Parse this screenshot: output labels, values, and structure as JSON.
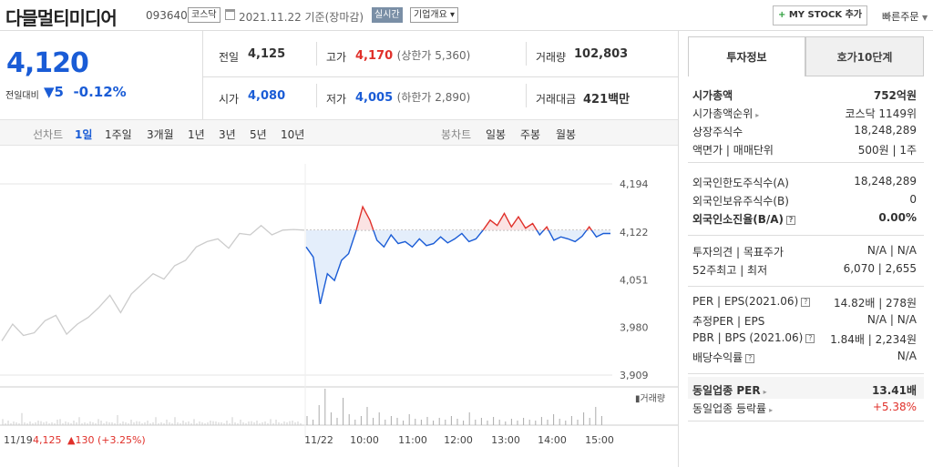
{
  "header": {
    "title": "다믈멀티미디어",
    "code": "093640",
    "market": "코스닥",
    "date": "2021.11.22  기준(장마감)",
    "realtime": "실시간",
    "company_info": "기업개요 ▾",
    "mystock": "MY STOCK 추가",
    "mystock_plus": "+",
    "quick_order": "빠른주문"
  },
  "summary": {
    "price": "4,120",
    "change_label": "전일대비",
    "change_value": "▼5",
    "change_rate": "-0.12%",
    "prev_label": "전일",
    "prev": "4,125",
    "open_label": "시가",
    "open": "4,080",
    "high_label": "고가",
    "high": "4,170",
    "high_limit": "(상한가 5,360)",
    "low_label": "저가",
    "low": "4,005",
    "low_limit": "(하한가 2,890)",
    "volume_label": "거래량",
    "volume": "102,803",
    "amount_label": "거래대금",
    "amount": "421백만"
  },
  "periods": {
    "line_label": "선차트",
    "line": [
      "1일",
      "1주일",
      "3개월",
      "1년",
      "3년",
      "5년",
      "10년"
    ],
    "candle_label": "봉차트",
    "candle": [
      "일봉",
      "주봉",
      "월봉"
    ]
  },
  "chart": {
    "y_ticks": [
      "4,194",
      "4,122",
      "4,051",
      "3,980",
      "3,909"
    ],
    "x_labels": [
      "11/22",
      "10:00",
      "11:00",
      "12:00",
      "13:00",
      "14:00",
      "15:00"
    ],
    "prev_day_label": "11/19",
    "prev_close_text": "4,125",
    "prev_change": "▲130 (+3.25%)",
    "volume_legend": "거래량",
    "colors": {
      "up": "#e0302a",
      "down": "#1a5cd6",
      "prev": "#cccccc"
    }
  },
  "chart_data": {
    "type": "line",
    "series": [
      {
        "values": [
          3960,
          3985,
          3968,
          3972,
          3990,
          3998,
          3970,
          3985,
          3995,
          4010,
          4028,
          4002,
          4030,
          4045,
          4060,
          4052,
          4072,
          4080,
          4100,
          4108,
          4112,
          4098,
          4120,
          4118,
          4132,
          4118,
          4125,
          4126,
          4125
        ],
        "color": "#cccccc"
      },
      {
        "values": [
          4100,
          4085,
          4015,
          4060,
          4050,
          4080,
          4090,
          4122,
          4160,
          4140,
          4110,
          4100,
          4118,
          4105,
          4108,
          4100,
          4112,
          4102,
          4105,
          4115,
          4106,
          4112,
          4120,
          4108,
          4112,
          4125,
          4140,
          4132,
          4150,
          4130,
          4145,
          4128,
          4135,
          4118,
          4130,
          4110,
          4115,
          4112,
          4108,
          4116,
          4130,
          4115,
          4120,
          4120
        ],
        "color": "#1a5cd6"
      }
    ],
    "base_value": 4125,
    "ylim": [
      3909,
      4194
    ]
  },
  "tabs": {
    "active": "투자정보",
    "other": "호가10단계"
  },
  "invest": {
    "group1": [
      {
        "k": "시가총액",
        "v": "752억원"
      },
      {
        "k": "시가총액순위",
        "v": "코스닥 1149위"
      },
      {
        "k": "상장주식수",
        "v": "18,248,289"
      },
      {
        "k": "액면가 | 매매단위",
        "v": "500원 | 1주"
      }
    ],
    "group2": [
      {
        "k": "외국인한도주식수(A)",
        "v": "18,248,289"
      },
      {
        "k": "외국인보유주식수(B)",
        "v": "0"
      },
      {
        "k": "외국인소진율(B/A)",
        "v": "0.00%"
      }
    ],
    "group3": [
      {
        "k": "투자의견 | 목표주가",
        "v": "N/A | N/A"
      },
      {
        "k": "52주최고 | 최저",
        "v": "6,070 | 2,655"
      }
    ],
    "group4": [
      {
        "k": "PER | EPS(2021.06)",
        "v": "14.82배 | 278원"
      },
      {
        "k": "추정PER | EPS",
        "v": "N/A | N/A"
      },
      {
        "k": "PBR | BPS (2021.06)",
        "v": "1.84배 | 2,234원"
      },
      {
        "k": "배당수익률",
        "v": "N/A"
      }
    ],
    "group5": [
      {
        "k": "동일업종 PER",
        "v": "13.41배"
      },
      {
        "k": "동일업종 등락률",
        "v": "+5.38%"
      }
    ]
  }
}
